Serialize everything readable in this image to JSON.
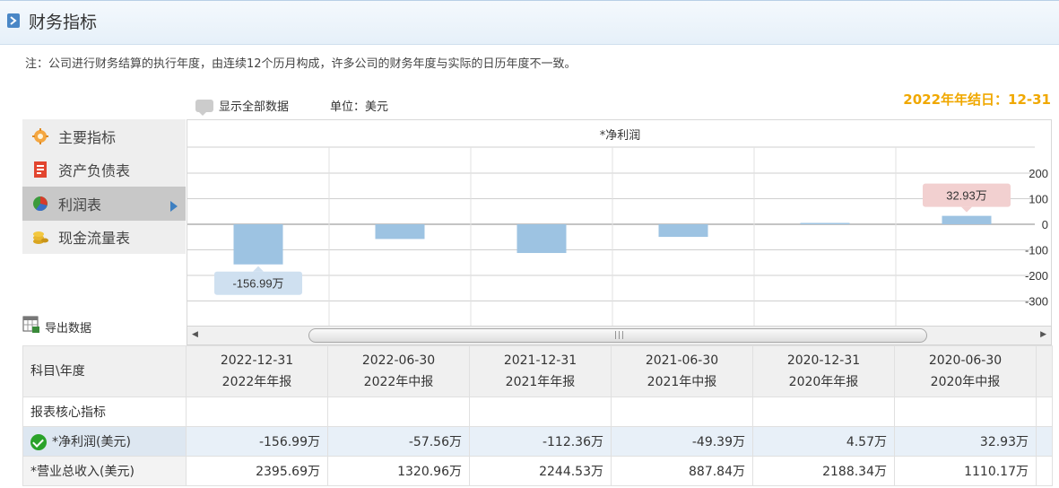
{
  "header": {
    "title": "财务指标"
  },
  "note": "注：公司进行财务结算的执行年度，由连续12个历月构成，许多公司的财务年度与实际的日历年度不一致。",
  "toolbar": {
    "show_all": "显示全部数据",
    "unit": "单位：美元",
    "year_end": "2022年年结日：12-31"
  },
  "sidebar": {
    "items": [
      {
        "label": "主要指标",
        "icon": "gear-flower-icon"
      },
      {
        "label": "资产负债表",
        "icon": "document-icon"
      },
      {
        "label": "利润表",
        "icon": "pie-chart-icon",
        "active": true
      },
      {
        "label": "现金流量表",
        "icon": "coins-icon"
      }
    ]
  },
  "export_label": "导出数据",
  "chart_data": {
    "type": "bar",
    "title": "*净利润",
    "categories": [
      "2022-12-31",
      "2022-06-30",
      "2021-12-31",
      "2021-06-30",
      "2020-12-31",
      "2020-06-30"
    ],
    "values": [
      -156.99,
      -57.56,
      -112.36,
      -49.39,
      4.57,
      32.93
    ],
    "ylim": [
      -400,
      300
    ],
    "yticks": [
      200,
      100,
      0,
      -100,
      -200,
      -300
    ],
    "ytick_labels": [
      "200",
      "100",
      "0",
      "-100",
      "-200",
      "-300"
    ],
    "callouts": [
      {
        "index": 0,
        "text": "-156.99万"
      },
      {
        "index": 5,
        "text": "32.93万"
      }
    ],
    "bar_color": "#9dc3e2",
    "grid": true
  },
  "table": {
    "header_label": "科目\\年度",
    "columns": [
      {
        "date": "2022-12-31",
        "period": "2022年年报"
      },
      {
        "date": "2022-06-30",
        "period": "2022年中报"
      },
      {
        "date": "2021-12-31",
        "period": "2021年年报"
      },
      {
        "date": "2021-06-30",
        "period": "2021年中报"
      },
      {
        "date": "2020-12-31",
        "period": "2020年年报"
      },
      {
        "date": "2020-06-30",
        "period": "2020年中报"
      }
    ],
    "section_label": "报表核心指标",
    "rows": [
      {
        "label": "*净利润(美元)",
        "values": [
          "-156.99万",
          "-57.56万",
          "-112.36万",
          "-49.39万",
          "4.57万",
          "32.93万"
        ]
      },
      {
        "label": "*营业总收入(美元)",
        "values": [
          "2395.69万",
          "1320.96万",
          "2244.53万",
          "887.84万",
          "2188.34万",
          "1110.17万"
        ]
      }
    ]
  },
  "colors": {
    "accent": "#4a87c6",
    "year_end": "#f0a800",
    "callout_neg": "#cfe0f0",
    "callout_pos": "#f2d0d0"
  }
}
